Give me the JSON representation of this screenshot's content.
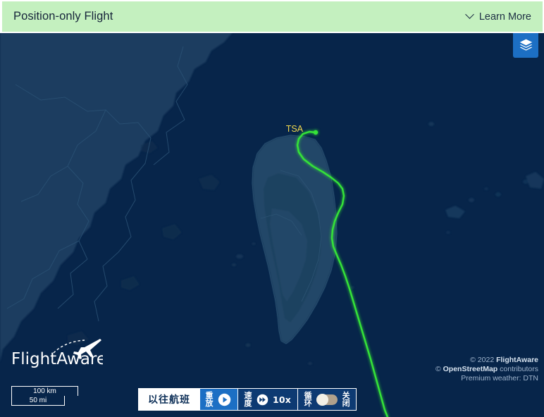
{
  "banner": {
    "title": "Position-only Flight",
    "learn_more_label": "Learn More",
    "chevron_icon": "chevron-down-icon",
    "background_color": "#c4f0bf"
  },
  "map": {
    "layers_button_icon": "layers-icon",
    "airport_label": "TSA",
    "airport_label_color": "#f2d94e",
    "track_color": "#35e338",
    "ocean_color": "#07254a",
    "land_color": "#1e3d60",
    "scale": {
      "km_label": "100 km",
      "mi_label": "50 mi"
    },
    "logo": {
      "text": "FlightAware",
      "icon": "airplane-icon"
    },
    "attribution": {
      "line1_prefix": "© 2022 ",
      "line1_brand": "FlightAware",
      "line2_prefix": "© ",
      "line2_brand": "OpenStreetMap",
      "line2_suffix": " contributors",
      "line3": "Premium weather: DTN"
    }
  },
  "replay_controls": {
    "past_flights_label": "以往航班",
    "replay": {
      "label_line1": "重",
      "label_line2": "放",
      "icon": "play-icon"
    },
    "speed": {
      "label_line1": "速",
      "label_line2": "度",
      "icon": "fast-forward-icon",
      "value": "10x"
    },
    "loop": {
      "label_line1": "循",
      "label_line2": "环",
      "state_label_line1": "关",
      "state_label_line2": "闭",
      "enabled": false
    }
  }
}
